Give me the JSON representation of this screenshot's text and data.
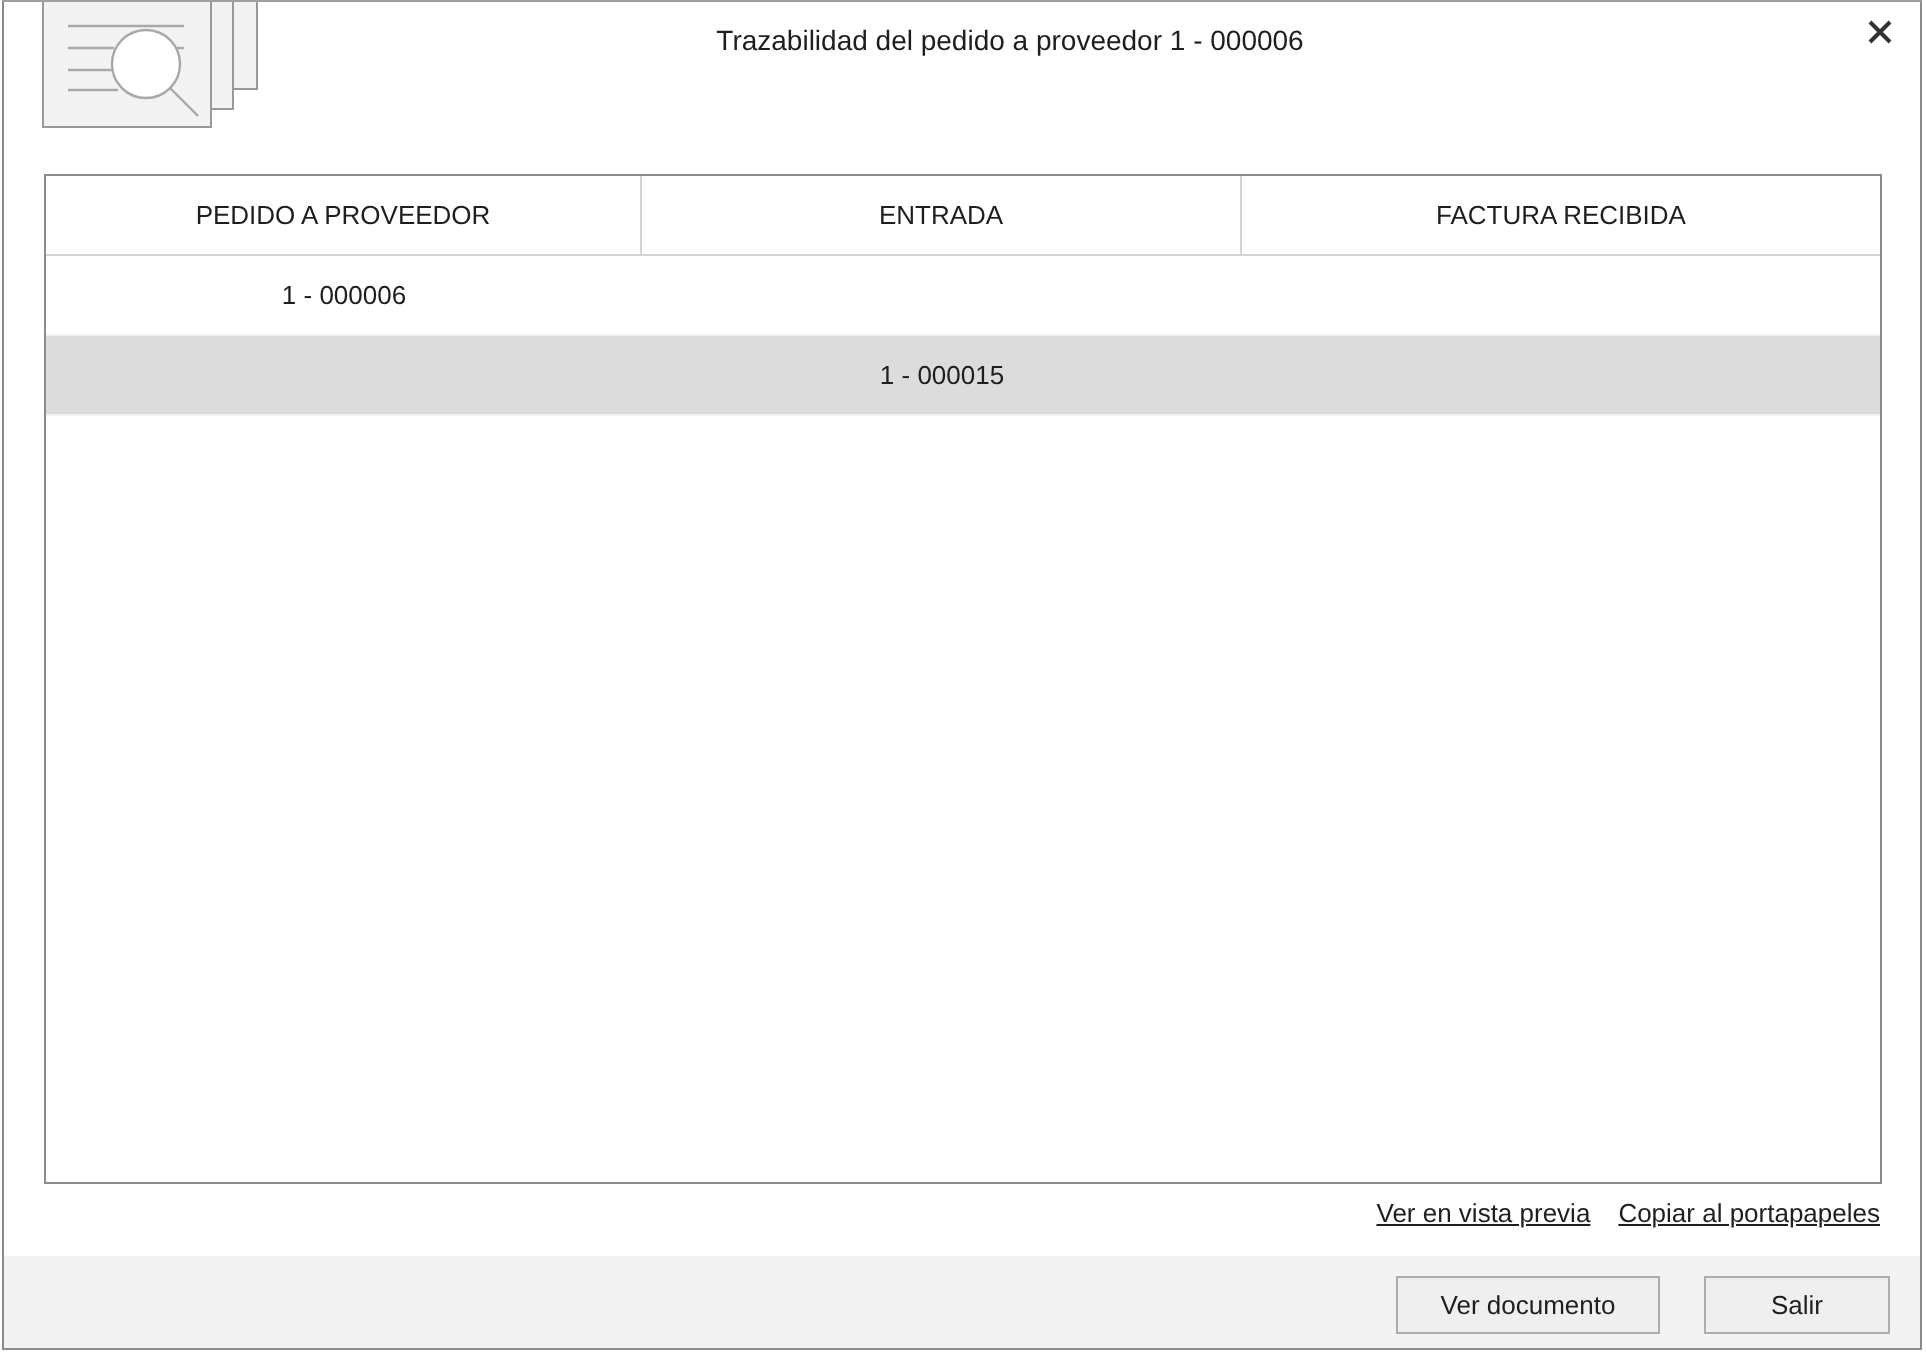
{
  "window": {
    "title": "Trazabilidad del pedido a proveedor 1 - 000006"
  },
  "table": {
    "columns": [
      "PEDIDO A PROVEEDOR",
      "ENTRADA",
      "FACTURA RECIBIDA"
    ],
    "rows": [
      {
        "selected": false,
        "cells": [
          "1 - 000006",
          null,
          null
        ]
      },
      {
        "selected": true,
        "cells": [
          null,
          "1 - 000015",
          null
        ]
      }
    ]
  },
  "links": [
    "Ver en vista previa",
    "Copiar al portapapeles"
  ],
  "buttons": [
    "Ver documento",
    "Salir"
  ]
}
